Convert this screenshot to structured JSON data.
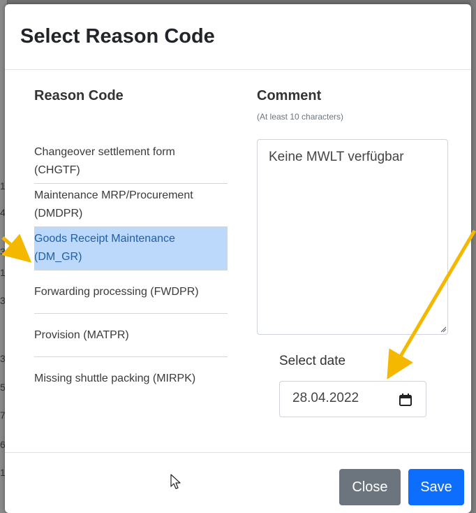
{
  "background": {
    "digits": [
      "1",
      "4",
      "3",
      "1",
      "3",
      "3",
      "5",
      "7",
      "6",
      "1"
    ]
  },
  "modal": {
    "title": "Select Reason Code"
  },
  "reason_column": {
    "heading": "Reason Code",
    "items": [
      {
        "line1": "Changeover settlement form",
        "line2": "(CHGTF)",
        "selected": false
      },
      {
        "line1": "Maintenance MRP/Procurement",
        "line2": "(DMDPR)",
        "selected": false
      },
      {
        "line1": "Goods Receipt Maintenance",
        "line2": "(DM_GR)",
        "selected": true
      },
      {
        "line1": "Forwarding processing (FWDPR)",
        "line2": "",
        "selected": false
      },
      {
        "line1": "Provision (MATPR)",
        "line2": "",
        "selected": false
      },
      {
        "line1": "Missing shuttle packing (MIRPK)",
        "line2": "",
        "selected": false
      }
    ]
  },
  "comment_column": {
    "heading": "Comment",
    "hint": "(At least 10 characters)",
    "value": "Keine MWLT verfügbar"
  },
  "date": {
    "label": "Select date",
    "value": "28.04.2022",
    "icon": "calendar-icon"
  },
  "footer": {
    "close_label": "Close",
    "save_label": "Save"
  },
  "colors": {
    "selected_bg": "#bcd9fb",
    "primary": "#0d6efd",
    "secondary": "#6c757d",
    "annotation_arrow": "#f5b800"
  }
}
